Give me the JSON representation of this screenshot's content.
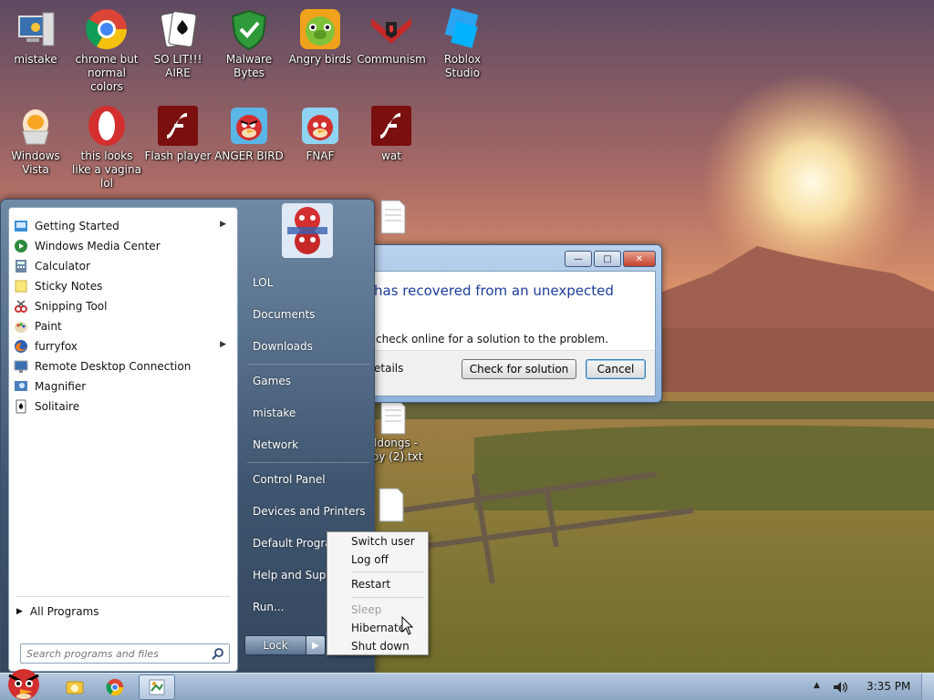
{
  "desktop": {
    "icons_row1": [
      {
        "label": "mistake",
        "icon": "computer-icon"
      },
      {
        "label": "chrome but normal colors",
        "icon": "chrome-icon"
      },
      {
        "label": "SO LIT!!! AIRE",
        "icon": "solitaire-icon"
      },
      {
        "label": "Malware Bytes",
        "icon": "shield-icon"
      },
      {
        "label": "Angry birds",
        "icon": "angry-birds-pig-icon"
      },
      {
        "label": "Communism",
        "icon": "communism-icon"
      },
      {
        "label": "Roblox Studio",
        "icon": "roblox-studio-icon"
      }
    ],
    "icons_row2": [
      {
        "label": "Windows Vista",
        "icon": "egg-icon"
      },
      {
        "label": "this looks like a vagina lol",
        "icon": "opera-icon"
      },
      {
        "label": "Flash player",
        "icon": "flash-icon"
      },
      {
        "label": "ANGER BIRD",
        "icon": "angry-bird-icon"
      },
      {
        "label": "FNAF",
        "icon": "angry-bird-icon"
      },
      {
        "label": "wat",
        "icon": "flash-icon"
      }
    ],
    "partial_file_label_1": "ldongs -",
    "partial_file_label_2": "ppy (2).txt"
  },
  "dialog": {
    "title_text": "has recovered from an unexpected",
    "message": "check online for a solution to the problem.",
    "details_label": "etails",
    "check_button": "Check for solution",
    "cancel_button": "Cancel",
    "minimize": "—",
    "maximize": "□",
    "close": "✕"
  },
  "start_menu": {
    "left_items": [
      {
        "label": "Getting Started",
        "icon": "getting-started-icon",
        "has_submenu": true
      },
      {
        "label": "Windows Media Center",
        "icon": "media-center-icon",
        "has_submenu": false
      },
      {
        "label": "Calculator",
        "icon": "calculator-icon",
        "has_submenu": false
      },
      {
        "label": "Sticky Notes",
        "icon": "sticky-notes-icon",
        "has_submenu": false
      },
      {
        "label": "Snipping Tool",
        "icon": "snipping-tool-icon",
        "has_submenu": false
      },
      {
        "label": "Paint",
        "icon": "paint-icon",
        "has_submenu": false
      },
      {
        "label": "furryfox",
        "icon": "firefox-icon",
        "has_submenu": true
      },
      {
        "label": "Remote Desktop Connection",
        "icon": "remote-desktop-icon",
        "has_submenu": false
      },
      {
        "label": "Magnifier",
        "icon": "magnifier-icon",
        "has_submenu": false
      },
      {
        "label": "Solitaire",
        "icon": "solitaire-icon",
        "has_submenu": false
      }
    ],
    "submenu_arrow": "▶",
    "all_programs": "All Programs",
    "all_programs_arrow": "▶",
    "search_placeholder": "Search programs and files",
    "right_items": [
      "LOL",
      "Documents",
      "Downloads",
      "Games",
      "mistake",
      "Network",
      "Control Panel",
      "Devices and Printers",
      "Default Programs",
      "Help and Support",
      "Run..."
    ],
    "lock_label": "Lock",
    "lock_arrow": "▶"
  },
  "context_menu": {
    "items": [
      {
        "label": "Switch user",
        "disabled": false
      },
      {
        "label": "Log off",
        "disabled": false
      },
      {
        "label": "Restart",
        "disabled": false
      },
      {
        "label": "Sleep",
        "disabled": true
      },
      {
        "label": "Hibernate",
        "disabled": false
      },
      {
        "label": "Shut down",
        "disabled": false
      }
    ]
  },
  "taskbar": {
    "clock": "3:35 PM",
    "tray_arrow": "▲",
    "pinned": [
      "explorer-icon",
      "chrome-icon",
      "paint-icon"
    ]
  },
  "colors": {
    "dialog_title": "#1e3d9a",
    "start_menu_bg": "#3f5670",
    "taskbar_bg": "#9cb4d0"
  }
}
